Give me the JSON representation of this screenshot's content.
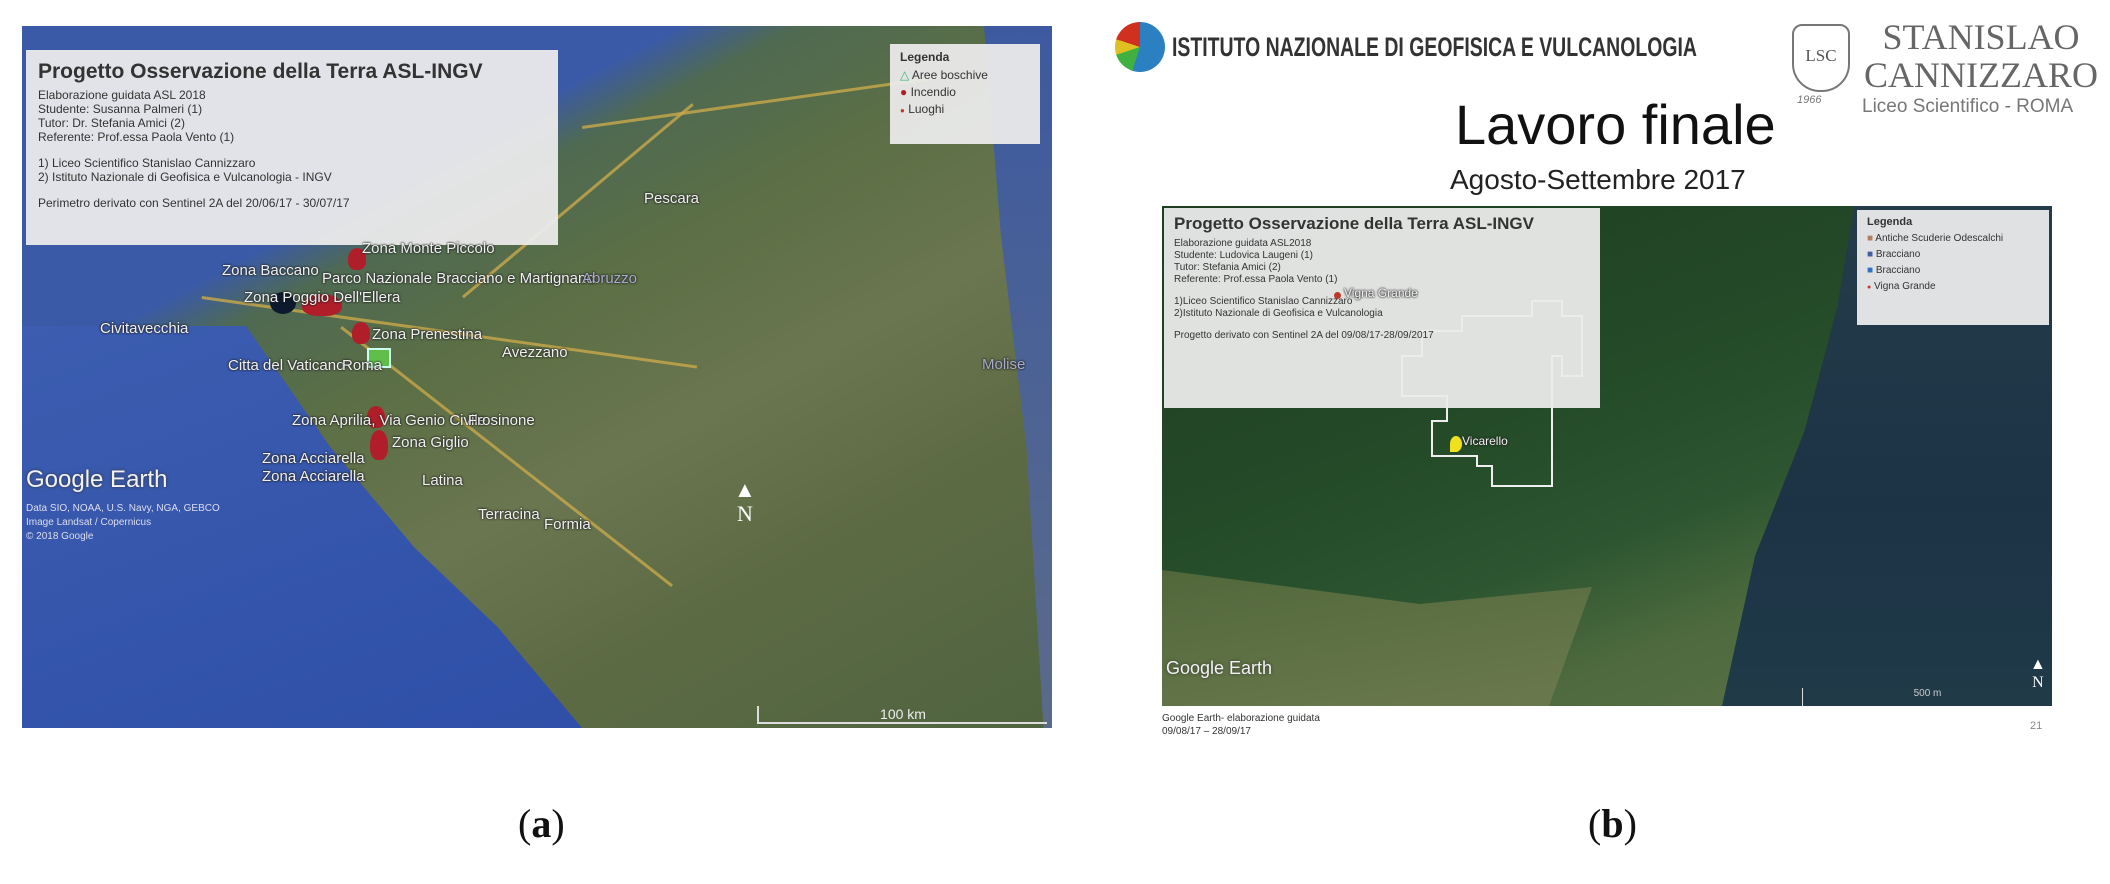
{
  "panel_a": {
    "info_title": "Progetto Osservazione della Terra ASL-INGV",
    "info_lines": [
      "Elaborazione guidata ASL 2018",
      "Studente: Susanna Palmeri (1)",
      "Tutor: Dr. Stefania Amici (2)",
      "Referente: Prof.essa Paola Vento (1)",
      "",
      "1) Liceo Scientifico Stanislao Cannizzaro",
      "2) Istituto Nazionale di Geofisica e Vulcanologia - INGV",
      "",
      "Perimetro derivato con Sentinel 2A del 20/06/17 - 30/07/17"
    ],
    "legend_title": "Legenda",
    "legend_items": [
      {
        "label": "Aree boschive",
        "icon": "triangle-icon",
        "color": "#3cb371"
      },
      {
        "label": "Incendio",
        "icon": "fire-icon",
        "color": "#b01e2a"
      },
      {
        "label": "Luoghi",
        "icon": "dot-icon",
        "color": "#c0392b"
      }
    ],
    "places": [
      "Pescara",
      "Zona Monte Piccolo",
      "Zona Baccano",
      "Parco Nazionale Bracciano e Martignano",
      "Zona Poggio Dell'Ellera",
      "Civitavecchia",
      "Abruzzo",
      "Avezzano",
      "Zona Prenestina",
      "Citta del Vaticano",
      "Roma",
      "Zona Aprilia, Via Genio Civile",
      "Frosinone",
      "Zona Giglio",
      "Zona Acciarella",
      "Zona Acciarella",
      "Latina",
      "Terracina",
      "Formia",
      "Molise"
    ],
    "google_earth": "Google Earth",
    "credits": [
      "Data SIO, NOAA, U.S. Navy, NGA, GEBCO",
      "Image Landsat / Copernicus",
      "© 2018 Google"
    ],
    "scale": "100 km",
    "north": "N",
    "caption_letter": "a"
  },
  "panel_b": {
    "ingv_logo_text": "ISTITUTO NAZIONALE DI GEOFISICA E VULCANOLOGIA",
    "school_logo": {
      "line1": "STANISLAO",
      "line2": "CANNIZZARO",
      "line3": "Liceo Scientifico - ROMA",
      "monogram": "LSC",
      "year": "1966"
    },
    "slide_title": "Lavoro finale",
    "slide_subtitle": "Agosto-Settembre 2017",
    "info_title": "Progetto Osservazione della Terra ASL-INGV",
    "info_lines": [
      "Elaborazione guidata ASL2018",
      "Studente: Ludovica Laugeni (1)",
      "Tutor: Stefania Amici (2)",
      "Referente: Prof.essa Paola Vento (1)",
      "",
      "1)Liceo Scientifico Stanislao Cannizzaro",
      "2)Istituto Nazionale di Geofisica e Vulcanologia",
      "",
      "Progetto derivato con Sentinel 2A del 09/08/17-28/09/2017"
    ],
    "legend_title": "Legenda",
    "legend_items": [
      {
        "label": "Antiche Scuderie Odescalchi",
        "color": "#b08060"
      },
      {
        "label": "Bracciano",
        "color": "#4060a0"
      },
      {
        "label": "Bracciano",
        "color": "#3070c0"
      },
      {
        "label": "Vigna Grande",
        "color": "#c0392b"
      }
    ],
    "places": [
      "Vigna Grande",
      "Vicarello"
    ],
    "google_earth": "Google Earth",
    "scale": "500 m",
    "north": "N",
    "footer_lines": [
      "Google Earth- elaborazione guidata",
      "09/08/17 – 28/09/17"
    ],
    "page_number": "21",
    "caption_letter": "b"
  }
}
